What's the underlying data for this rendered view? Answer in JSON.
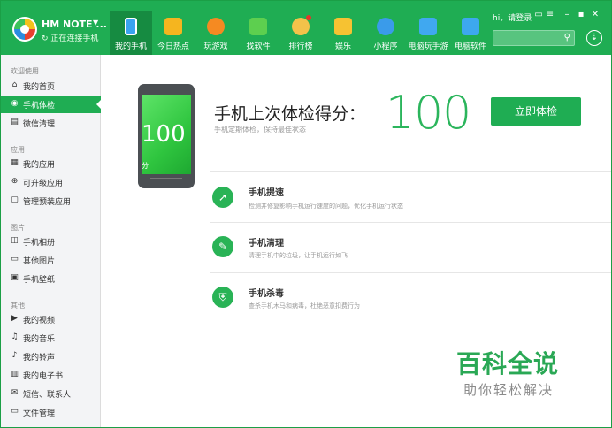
{
  "header": {
    "device_name": "HM NOTE ...",
    "device_status": "正在连接手机",
    "greeting": "hi，请登录",
    "tabs": [
      {
        "label": "我的手机",
        "icon": "phone-icon",
        "color": "#3aa3f0"
      },
      {
        "label": "今日热点",
        "icon": "hot-news-icon",
        "color": "#f5b51f"
      },
      {
        "label": "玩游戏",
        "icon": "game-icon",
        "color": "#f58a22"
      },
      {
        "label": "找软件",
        "icon": "android-icon",
        "color": "#5dcf4f"
      },
      {
        "label": "排行榜",
        "icon": "medal-icon",
        "color": "#f3c24a"
      },
      {
        "label": "娱乐",
        "icon": "entertainment-icon",
        "color": "#f6c232"
      },
      {
        "label": "小程序",
        "icon": "mini-program-icon",
        "color": "#3a9bea"
      },
      {
        "label": "电脑玩手游",
        "icon": "pc-game-icon",
        "color": "#40a8f0"
      },
      {
        "label": "电脑软件",
        "icon": "pc-software-icon",
        "color": "#3da8ee"
      }
    ]
  },
  "sidebar": {
    "groups": [
      {
        "title": "欢迎使用",
        "items": [
          {
            "label": "我的首页",
            "icon": "⌂"
          },
          {
            "label": "手机体检",
            "icon": "◉"
          },
          {
            "label": "微信清理",
            "icon": "▤"
          }
        ]
      },
      {
        "title": "应用",
        "items": [
          {
            "label": "我的应用",
            "icon": "▦"
          },
          {
            "label": "可升级应用",
            "icon": "⊕"
          },
          {
            "label": "管理预装应用",
            "icon": "▢"
          }
        ]
      },
      {
        "title": "图片",
        "items": [
          {
            "label": "手机相册",
            "icon": "◫"
          },
          {
            "label": "其他图片",
            "icon": "▭"
          },
          {
            "label": "手机壁纸",
            "icon": "▣"
          }
        ]
      },
      {
        "title": "其他",
        "items": [
          {
            "label": "我的视频",
            "icon": "▶"
          },
          {
            "label": "我的音乐",
            "icon": "♫"
          },
          {
            "label": "我的铃声",
            "icon": "♪"
          },
          {
            "label": "我的电子书",
            "icon": "▥"
          },
          {
            "label": "短信、联系人",
            "icon": "✉"
          },
          {
            "label": "文件管理",
            "icon": "▭"
          }
        ]
      }
    ]
  },
  "main": {
    "phone_score": "100",
    "phone_score_unit": "分",
    "title": "手机上次体检得分：",
    "subtitle": "手机定期体检，保持最佳状态",
    "score": "100",
    "check_button": "立即体检",
    "features": [
      {
        "title": "手机提速",
        "desc": "检测并修复影响手机运行速度的问题，优化手机运行状态",
        "icon": "rocket-icon"
      },
      {
        "title": "手机清理",
        "desc": "清理手机中的垃圾，让手机运行如飞",
        "icon": "broom-icon"
      },
      {
        "title": "手机杀毒",
        "desc": "查杀手机木马和病毒，杜绝恶意扣费行为",
        "icon": "shield-icon"
      }
    ]
  },
  "watermark": {
    "main": "百科全说",
    "sub": "助你轻松解决"
  }
}
